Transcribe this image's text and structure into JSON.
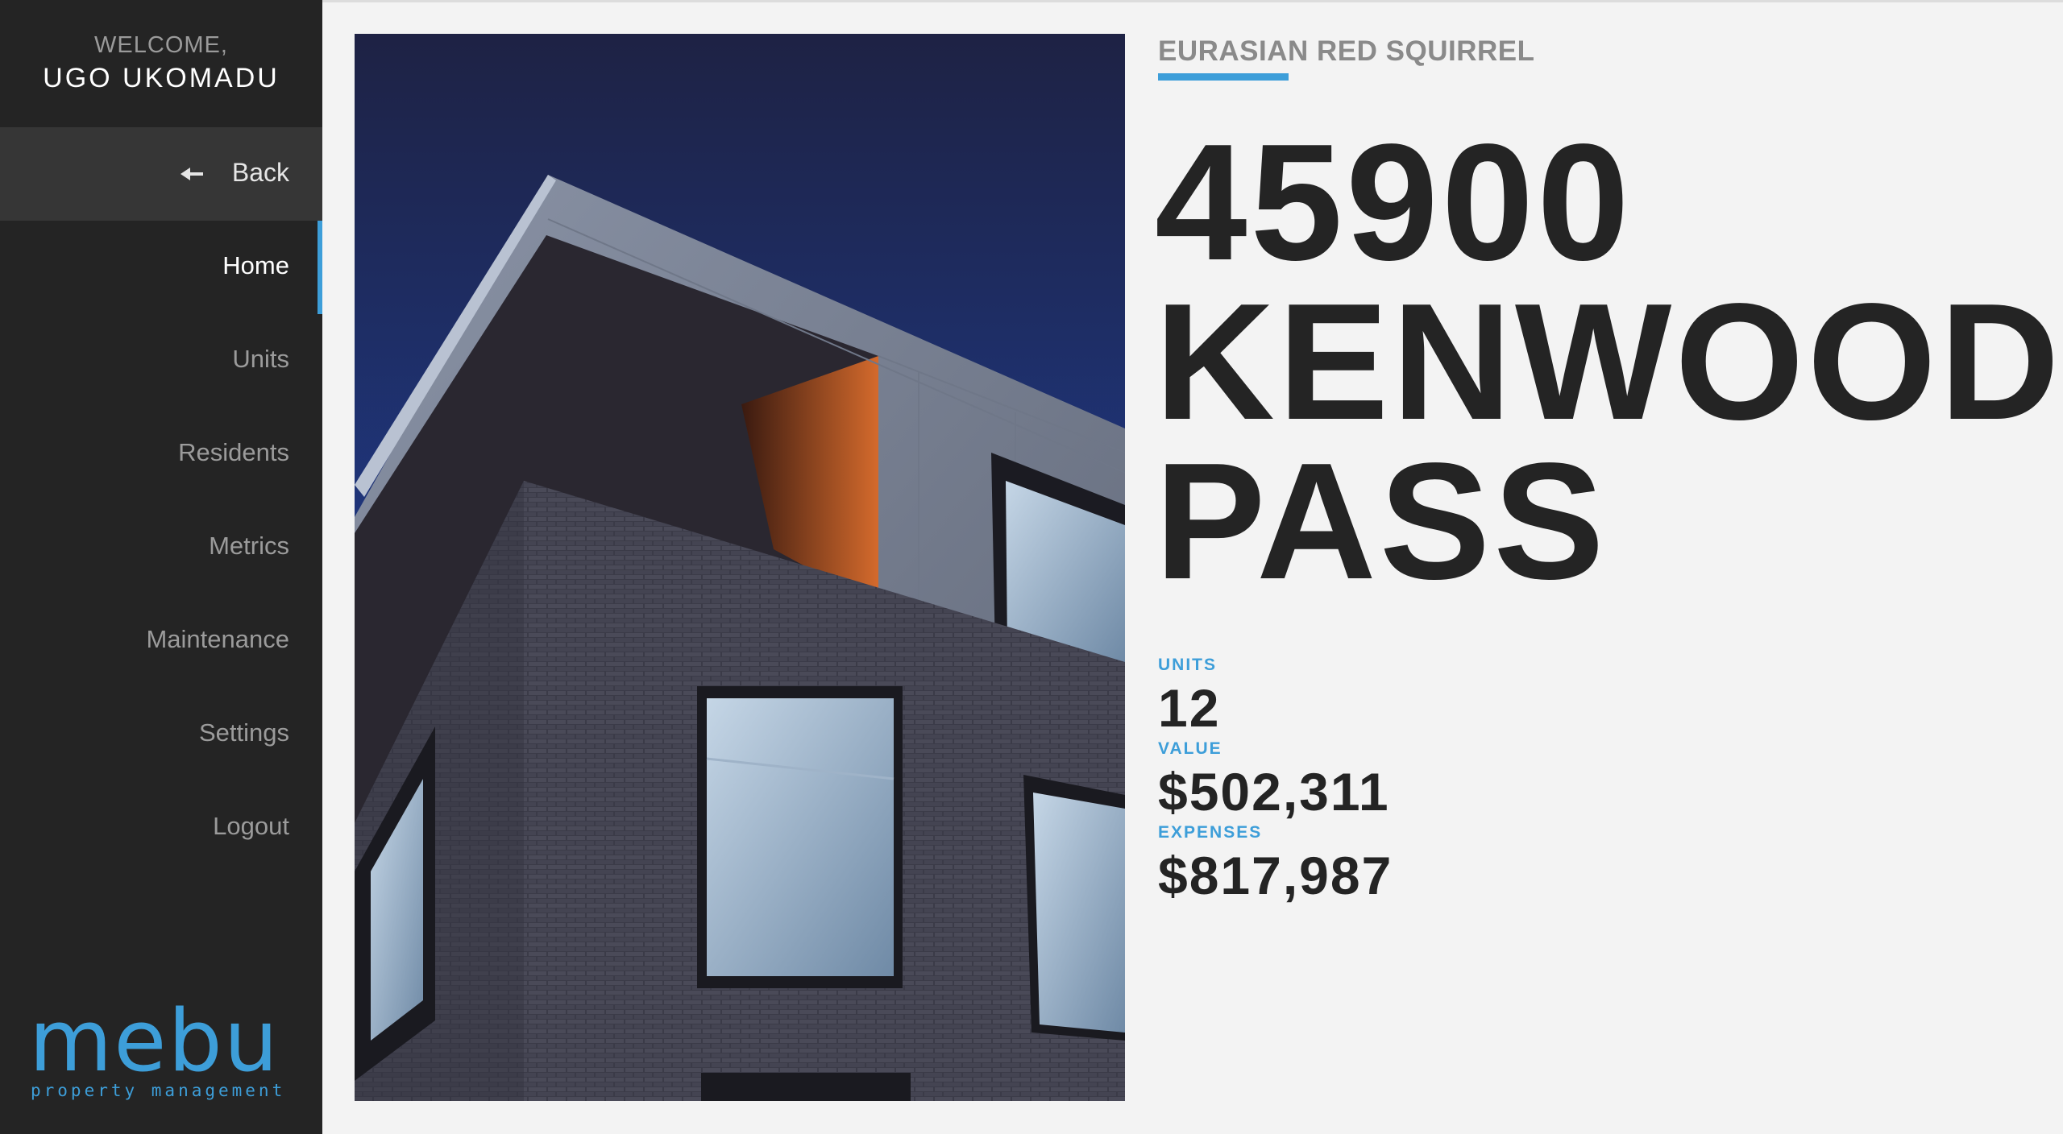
{
  "sidebar": {
    "welcome_line": "WELCOME,",
    "user_name": "UGO UKOMADU",
    "back_label": "Back",
    "nav": [
      {
        "label": "Home",
        "active": true
      },
      {
        "label": "Units",
        "active": false
      },
      {
        "label": "Residents",
        "active": false
      },
      {
        "label": "Metrics",
        "active": false
      },
      {
        "label": "Maintenance",
        "active": false
      },
      {
        "label": "Settings",
        "active": false
      },
      {
        "label": "Logout",
        "active": false
      }
    ],
    "logo": {
      "wordmark": "mebu",
      "tagline": "property management"
    }
  },
  "property": {
    "subtitle": "EURASIAN RED SQUIRREL",
    "address_lines": [
      "45900",
      "KENWOOD",
      "PASS"
    ],
    "stats": [
      {
        "label": "UNITS",
        "value": "12"
      },
      {
        "label": "VALUE",
        "value": "$502,311"
      },
      {
        "label": "EXPENSES",
        "value": "$817,987"
      }
    ]
  },
  "colors": {
    "accent": "#3d9ed9",
    "sidebar_bg": "#242424",
    "page_bg": "#f3f3f3",
    "text_dark": "#242424"
  },
  "icons": {
    "back": "arrow-left-icon"
  }
}
